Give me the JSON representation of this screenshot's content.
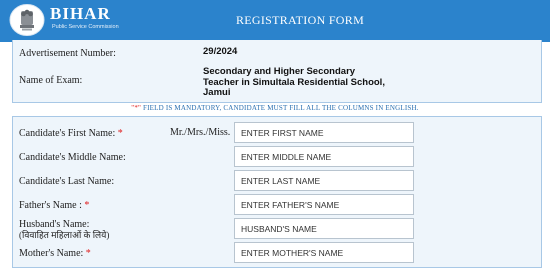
{
  "header": {
    "brand": "BIHAR",
    "brand_sub": "Public Service Commission",
    "title": "REGISTRATION FORM",
    "logo_icon": "bpsc-emblem-icon",
    "colors": {
      "bar": "#2b83cc"
    }
  },
  "advert": {
    "number_label": "Advertisement Number:",
    "number_value": "29/2024",
    "exam_label": "Name of Exam:",
    "exam_line1": "Secondary and Higher Secondary",
    "exam_line2": "Teacher in Simultala Residential School,",
    "exam_line3": "Jamui"
  },
  "notice": {
    "star": "\"*\"",
    "text": " FIELD IS MANDATORY, CANDIDATE MUST FILL ALL THE COLUMNS IN ENGLISH."
  },
  "form": {
    "title_prefix": "Mr./Mrs./Miss.",
    "fields": [
      {
        "label": "Candidate's First Name:",
        "required": "*",
        "placeholder": "ENTER FIRST NAME"
      },
      {
        "label": "Candidate's Middle Name:",
        "required": "",
        "placeholder": "ENTER MIDDLE NAME"
      },
      {
        "label": "Candidate's Last Name:",
        "required": "",
        "placeholder": "ENTER LAST NAME"
      },
      {
        "label": "Father's Name :",
        "required": "*",
        "placeholder": "ENTER FATHER'S NAME"
      },
      {
        "label": "Husband's Name:",
        "label2": "(विवाहित महिलाओं के लिये)",
        "required": "",
        "placeholder": "HUSBAND'S NAME"
      },
      {
        "label": "Mother's Name:",
        "required": "*",
        "placeholder": "ENTER MOTHER'S NAME"
      }
    ]
  }
}
